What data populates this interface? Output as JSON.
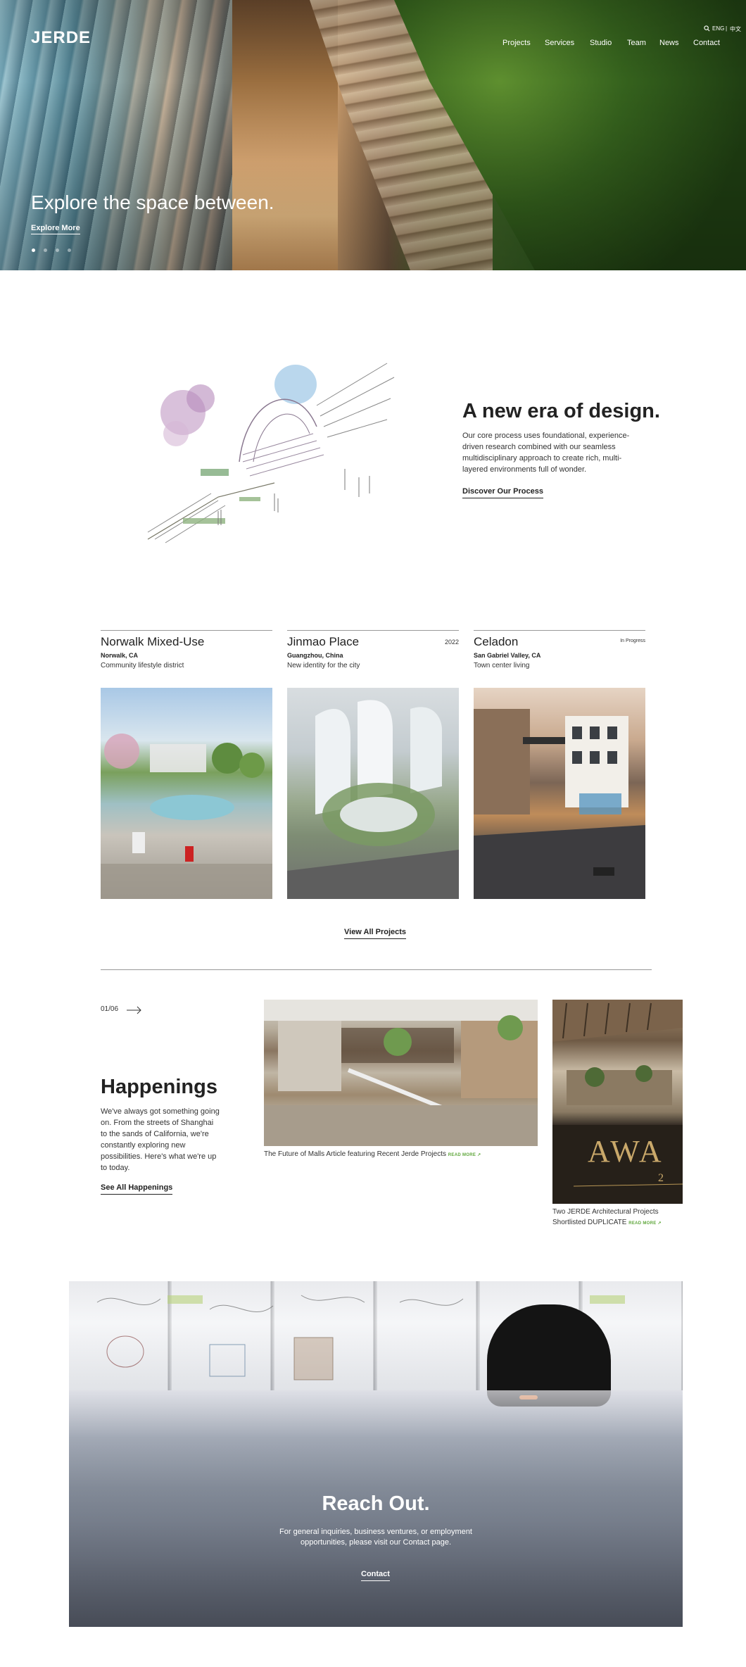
{
  "header": {
    "logo": "JERDE",
    "nav": [
      "Projects",
      "Services",
      "Studio",
      "Team",
      "News",
      "Contact"
    ],
    "lang_active": "ENG",
    "lang_other": "中文"
  },
  "hero": {
    "title": "Explore the space between.",
    "link": "Explore More",
    "slide_count": 4,
    "active_slide": 1
  },
  "intro": {
    "title": "A new era of design.",
    "body": "Our core process uses foundational, experience-driven research combined with our seamless multidisciplinary approach to create rich, multi-layered environments full of wonder.",
    "link": "Discover Our Process"
  },
  "projects": [
    {
      "name": "Norwalk Mixed-Use",
      "tag": "",
      "location": "Norwalk, CA",
      "description": "Community lifestyle district"
    },
    {
      "name": "Jinmao Place",
      "tag": "2022",
      "location": "Guangzhou, China",
      "description": "New identity for the city"
    },
    {
      "name": "Celadon",
      "tag": "In Progress",
      "location": "San Gabriel Valley, CA",
      "description": "Town center living"
    }
  ],
  "view_all": "View All Projects",
  "happenings": {
    "counter": "01/06",
    "title": "Happenings",
    "body": "We've always got something going on. From the streets of Shanghai to the sands of California, we're constantly exploring new possibilities. Here's what we're up to today.",
    "link": "See All Happenings",
    "cards": [
      {
        "caption": "The Future of Malls Article featuring Recent Jerde Projects",
        "readmore": "READ MORE ↗"
      },
      {
        "caption": "Two JERDE Architectural Projects Shortlisted DUPLICATE",
        "readmore": "READ MORE ↗",
        "image_text": "AWA",
        "image_sub": "2"
      }
    ]
  },
  "contact": {
    "title": "Reach Out.",
    "body": "For general inquiries, business ventures, or employment opportunities, please visit our Contact page.",
    "link": "Contact"
  }
}
